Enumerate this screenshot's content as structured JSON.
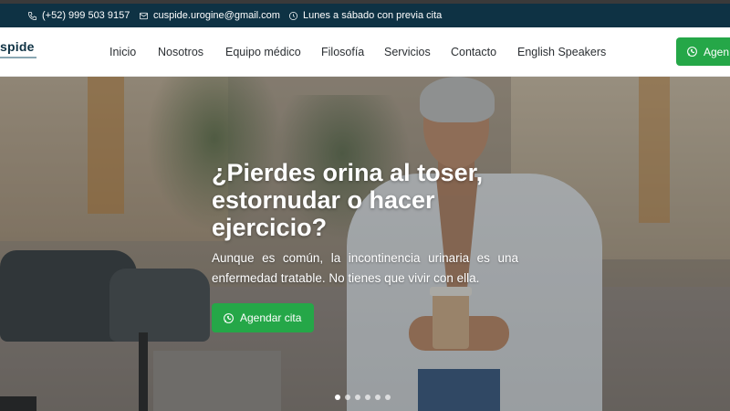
{
  "contact_bar": {
    "phone": "(+52) 999 503 9157",
    "email": "cuspide.urogine@gmail.com",
    "hours": "Lunes a sábado con previa cita",
    "phone_icon": "phone-icon",
    "email_icon": "mail-icon",
    "hours_icon": "clock-icon"
  },
  "brand": {
    "logo_text": "spide"
  },
  "nav": {
    "items": [
      "Inicio",
      "Nosotros",
      "Equipo médico",
      "Filosofía",
      "Servicios",
      "Contacto",
      "English Speakers"
    ],
    "cta_label": "Agen",
    "cta_icon": "whatsapp-icon"
  },
  "hero": {
    "title": "¿Pierdes orina al toser, estornudar o hacer ejercicio?",
    "subtitle": "Aunque es común, la incontinencia urinaria es una enfermedad tratable. No tienes que vivir con ella.",
    "button_label": "Agendar cita",
    "button_icon": "whatsapp-icon",
    "slide_count": 6,
    "active_slide": 1
  },
  "colors": {
    "top_bar": "#0e3244",
    "accent_green": "#25a748",
    "nav_text": "#2b2f33"
  }
}
